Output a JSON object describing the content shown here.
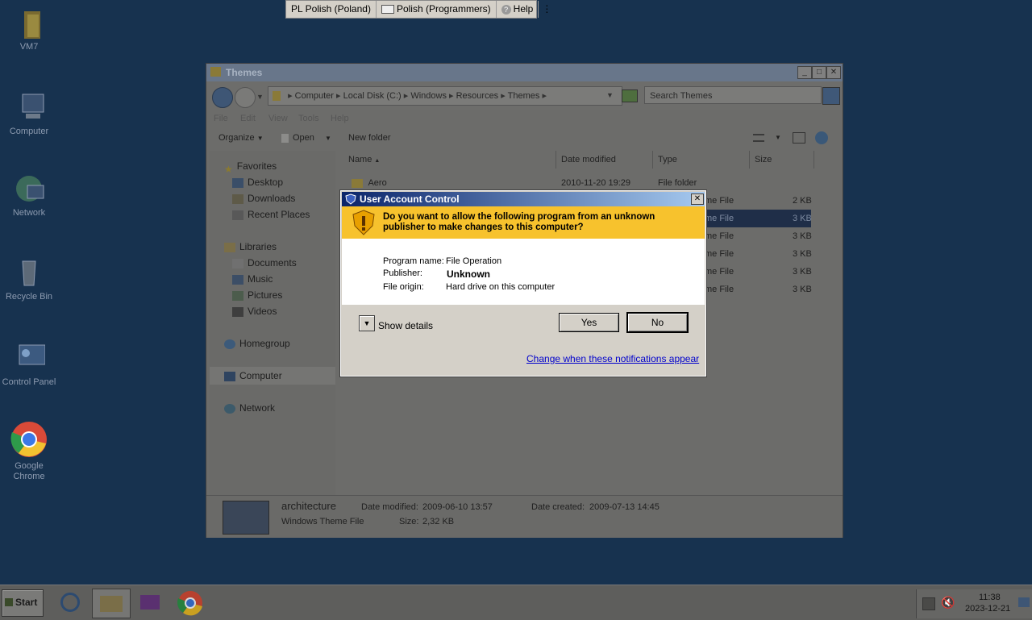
{
  "language_bar": {
    "lang": "PL Polish (Poland)",
    "layout": "Polish (Programmers)",
    "help": "Help"
  },
  "desktop_icons": [
    {
      "label": "VM7",
      "icon": "folder-icon"
    },
    {
      "label": "Computer",
      "icon": "computer-icon"
    },
    {
      "label": "Network",
      "icon": "network-icon"
    },
    {
      "label": "Recycle Bin",
      "icon": "recycle-bin-icon"
    },
    {
      "label": "Control Panel",
      "icon": "control-panel-icon"
    },
    {
      "label": "Google Chrome",
      "icon": "chrome-icon"
    }
  ],
  "explorer": {
    "title": "Themes",
    "breadcrumb": [
      "Computer",
      "Local Disk (C:)",
      "Windows",
      "Resources",
      "Themes"
    ],
    "search_placeholder": "Search Themes",
    "menu": [
      "File",
      "Edit",
      "View",
      "Tools",
      "Help"
    ],
    "toolbar": {
      "organize": "Organize",
      "open": "Open",
      "new_folder": "New folder"
    },
    "nav": {
      "favorites": "Favorites",
      "desktop": "Desktop",
      "downloads": "Downloads",
      "recent": "Recent Places",
      "libraries": "Libraries",
      "documents": "Documents",
      "music": "Music",
      "pictures": "Pictures",
      "videos": "Videos",
      "homegroup": "Homegroup",
      "computer": "Computer",
      "network": "Network"
    },
    "columns": {
      "name": "Name",
      "date": "Date modified",
      "type": "Type",
      "size": "Size"
    },
    "files": [
      {
        "name": "Aero",
        "date": "2010-11-20 19:29",
        "type": "File folder",
        "size": ""
      },
      {
        "name": "",
        "date": "",
        "type": "me File",
        "size": "2 KB"
      },
      {
        "name": "",
        "date": "",
        "type": "me File",
        "size": "3 KB"
      },
      {
        "name": "",
        "date": "",
        "type": "me File",
        "size": "3 KB"
      },
      {
        "name": "",
        "date": "",
        "type": "me File",
        "size": "3 KB"
      },
      {
        "name": "",
        "date": "",
        "type": "me File",
        "size": "3 KB"
      },
      {
        "name": "",
        "date": "",
        "type": "me File",
        "size": "3 KB"
      }
    ],
    "details": {
      "file_name": "architecture",
      "file_type": "Windows Theme File",
      "date_modified_label": "Date modified:",
      "date_modified": "2009-06-10 13:57",
      "date_created_label": "Date created:",
      "date_created": "2009-07-13 14:45",
      "size_label": "Size:",
      "size": "2,32 KB"
    }
  },
  "uac": {
    "title": "User Account Control",
    "question": "Do you want to allow the following program from an unknown publisher to make changes to this computer?",
    "program_name_label": "Program name:",
    "program_name": "File Operation",
    "publisher_label": "Publisher:",
    "publisher": "Unknown",
    "file_origin_label": "File origin:",
    "file_origin": "Hard drive on this computer",
    "show_details": "Show details",
    "yes": "Yes",
    "no": "No",
    "notifications_link": "Change when these notifications appear"
  },
  "taskbar": {
    "start": "Start",
    "time": "11:38",
    "date": "2023-12-21"
  }
}
